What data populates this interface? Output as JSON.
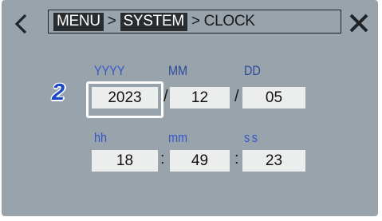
{
  "breadcrumb": {
    "items": [
      "MENU",
      "SYSTEM",
      "CLOCK"
    ],
    "separator": ">"
  },
  "step_number": "2",
  "date": {
    "year_label": "YYYY",
    "month_label": "MM",
    "day_label": "DD",
    "year": "2023",
    "month": "12",
    "day": "05",
    "separator": "/"
  },
  "time": {
    "hour_label": "hh",
    "minute_label": "mm",
    "second_label": "ss",
    "hour": "18",
    "minute": "49",
    "second": "23",
    "separator": ":"
  },
  "icons": {
    "back": "chevron-left-icon",
    "close": "close-icon"
  },
  "colors": {
    "screen_bg": "#98a3ab",
    "field_bg": "#eceded",
    "label_blue": "#3556c8",
    "step_blue": "#1b49c0"
  }
}
